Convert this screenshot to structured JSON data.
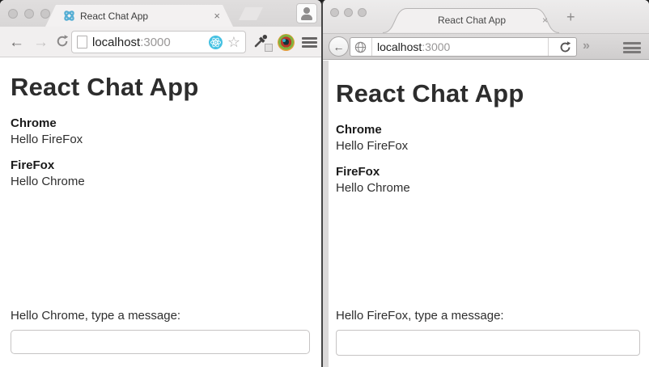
{
  "left_window": {
    "browser": "Chrome",
    "tab": {
      "title": "React Chat App",
      "close_glyph": "×"
    },
    "toolbar": {
      "back_glyph": "←",
      "forward_glyph": "→",
      "url_host": "localhost",
      "url_port": ":3000",
      "star_glyph": "☆"
    },
    "page": {
      "heading": "React Chat App",
      "messages": [
        {
          "sender": "Chrome",
          "text": "Hello FireFox"
        },
        {
          "sender": "FireFox",
          "text": "Hello Chrome"
        }
      ],
      "input_label": "Hello Chrome, type a message:",
      "input_value": ""
    }
  },
  "right_window": {
    "browser": "Firefox",
    "tab": {
      "title": "React Chat App",
      "close_glyph": "×",
      "new_tab_glyph": "+"
    },
    "toolbar": {
      "back_glyph": "←",
      "url_host": "localhost",
      "url_port": ":3000",
      "overflow_glyph": "»"
    },
    "page": {
      "heading": "React Chat App",
      "messages": [
        {
          "sender": "Chrome",
          "text": "Hello FireFox"
        },
        {
          "sender": "FireFox",
          "text": "Hello Chrome"
        }
      ],
      "input_label": "Hello FireFox, type a message:",
      "input_value": ""
    }
  },
  "colors": {
    "accent_react_blue": "#54aed4",
    "devtools_badge": "#45c1e2",
    "window_chrome_gray": "#dddbdb",
    "page_text": "#2e2e2e"
  }
}
